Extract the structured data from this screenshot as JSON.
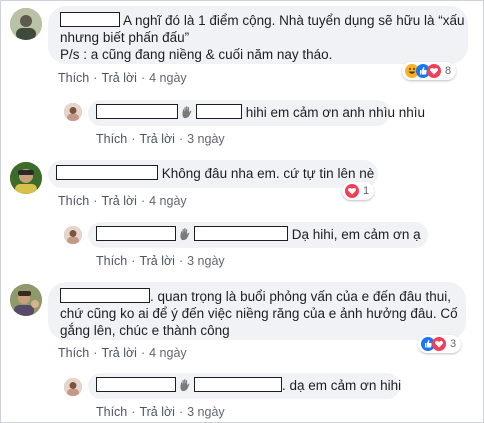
{
  "comments": [
    {
      "text_line1": "A nghĩ đó là 1 điểm cộng. Nhà tuyển dụng sẽ hữu là “xấu",
      "text_line2": "nhưng biết phấn đấu”",
      "text_line3": "P/s : a cũng đang niềng & cuối năm nay tháo.",
      "like": "Thích",
      "reply": "Trả lời",
      "time": "4 ngày",
      "reaction_icons": [
        "haha-icon",
        "like-icon",
        "love-icon"
      ],
      "reaction_count": "8",
      "reply_item": {
        "text": "hihi em cảm ơn anh nhìu nhìu",
        "like": "Thích",
        "reply": "Trả lời",
        "time": "3 ngày"
      }
    },
    {
      "text_line1": "Không đâu nha em. cứ tự tin lên nè",
      "like": "Thích",
      "reply": "Trả lời",
      "time": "4 ngày",
      "reaction_icons": [
        "love-icon"
      ],
      "reaction_count": "1",
      "reply_item": {
        "text": "Dạ hihi, em cảm ơn ạ",
        "like": "Thích",
        "reply": "Trả lời",
        "time": "3 ngày"
      }
    },
    {
      "text_line1": ". quan trọng là buổi phỏng vấn của e đến đâu thui,",
      "text_line2": "chứ cũng ko ai để ý đến việc niềng răng của e ảnh hưởng đâu. Cố",
      "text_line3": "gắng lên, chúc e thành công",
      "like": "Thích",
      "reply": "Trả lời",
      "time": "4 ngày",
      "reaction_icons": [
        "like-icon",
        "love-icon"
      ],
      "reaction_count": "3",
      "reply_item": {
        "text": ". dạ em cảm ơn hihi",
        "like": "Thích",
        "reply": "Trả lời",
        "time": "3 ngày"
      }
    }
  ],
  "colors": {
    "bubble": "#f0f2f5",
    "link": "#4b5563",
    "like_blue": "#1877f2",
    "love_red": "#f33e58",
    "haha_yellow": "#f7b125"
  }
}
